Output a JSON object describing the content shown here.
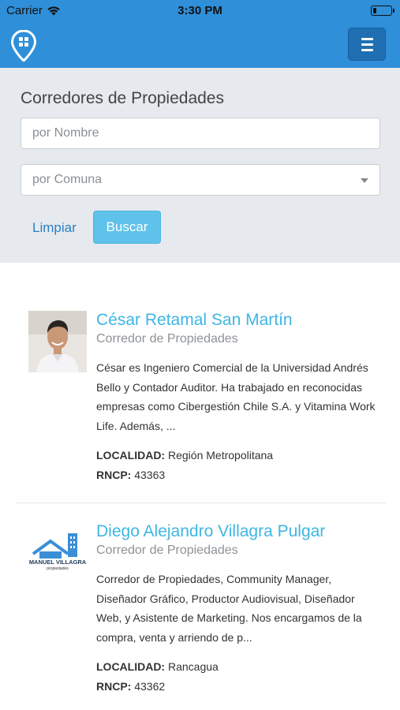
{
  "status_bar": {
    "carrier": "Carrier",
    "time": "3:30 PM",
    "battery_level": 0.2
  },
  "navbar": {
    "logo_icon": "map-pin-grid-icon",
    "menu_icon": "hamburger-menu-icon",
    "color": "#2f8fd8"
  },
  "search": {
    "title": "Corredores de Propiedades",
    "name_placeholder": "por Nombre",
    "comuna_placeholder": "por Comuna",
    "clear_label": "Limpiar",
    "search_label": "Buscar"
  },
  "brokers": [
    {
      "name": "César Retamal San Martín",
      "role": "Corredor de Propiedades",
      "description": "César es Ingeniero Comercial de la Universidad Andrés Bello y Contador Auditor. Ha trabajado en reconocidas empresas como Cibergestión Chile S.A. y Vitamina Work Life. Además, ...",
      "localidad_label": "LOCALIDAD:",
      "localidad": "Región Metropolitana",
      "rncp_label": "RNCP:",
      "rncp": "43363"
    },
    {
      "name": "Diego Alejandro Villagra Pulgar",
      "role": "Corredor de Propiedades",
      "description": "Corredor de Propiedades, Community Manager, Diseñador Gráfico, Productor Audiovisual, Diseñador Web, y Asistente de Marketing. Nos encargamos de la compra, venta y arriendo de p...",
      "localidad_label": "LOCALIDAD:",
      "localidad": "Rancagua",
      "rncp_label": "RNCP:",
      "rncp": "43362",
      "logo_text": "MANUEL VILLAGRA",
      "logo_subtext": "propiedades"
    }
  ]
}
